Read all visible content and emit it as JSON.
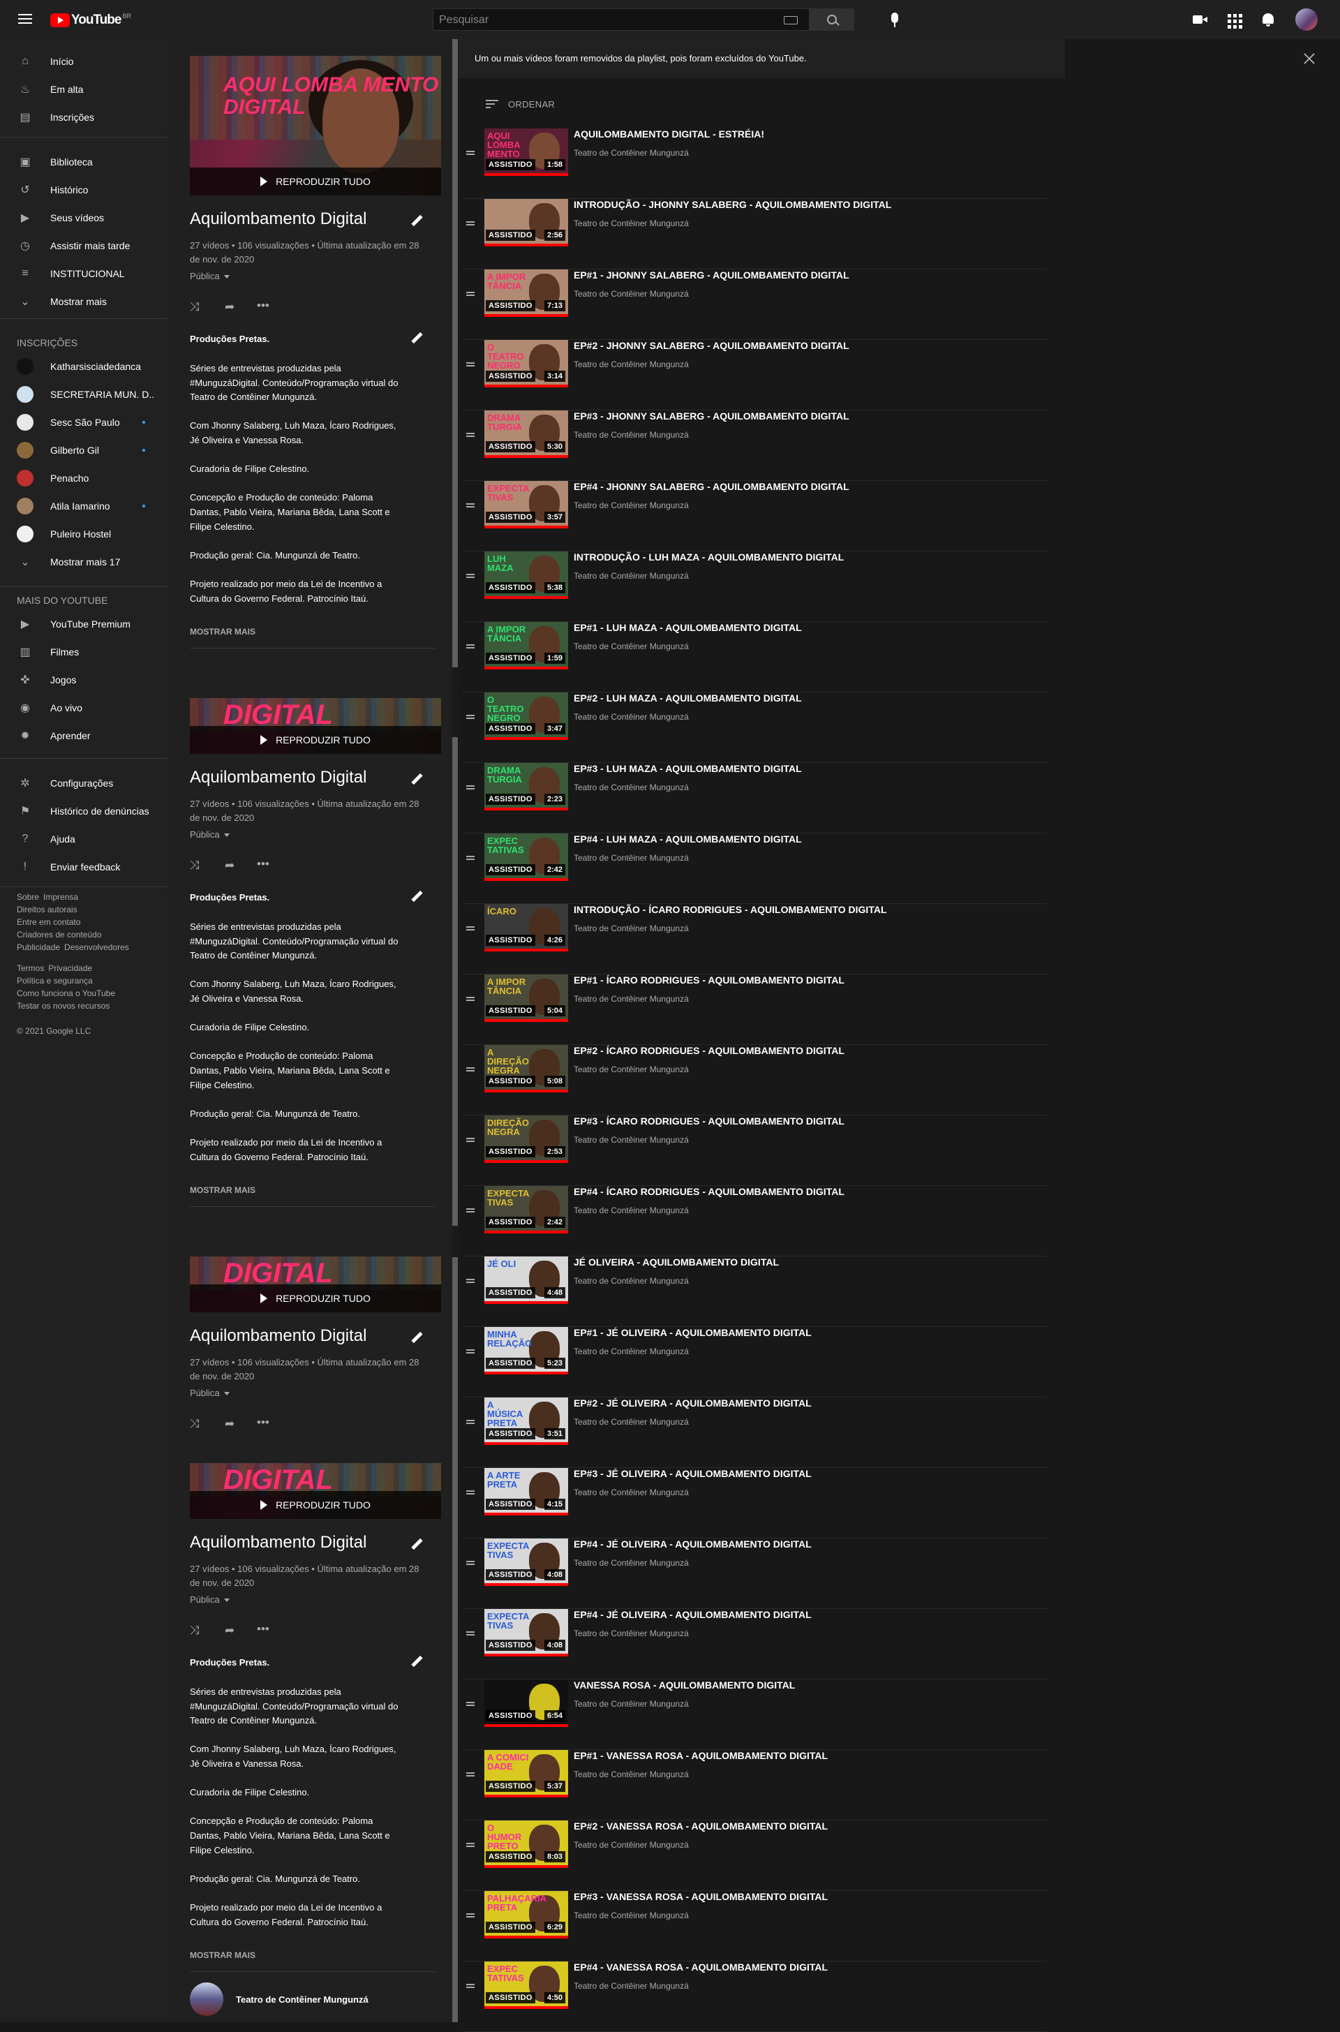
{
  "topbar": {
    "logo": "YouTube",
    "region": "BR",
    "search_placeholder": "Pesquisar"
  },
  "sidebar": {
    "main": [
      {
        "label": "Início",
        "icon": "home-icon"
      },
      {
        "label": "Em alta",
        "icon": "fire-icon"
      },
      {
        "label": "Inscrições",
        "icon": "subscriptions-icon"
      }
    ],
    "library": [
      {
        "label": "Biblioteca",
        "icon": "library-icon"
      },
      {
        "label": "Histórico",
        "icon": "history-icon"
      },
      {
        "label": "Seus vídeos",
        "icon": "your-videos-icon"
      },
      {
        "label": "Assistir mais tarde",
        "icon": "clock-icon"
      },
      {
        "label": "INSTITUCIONAL",
        "icon": "playlist-icon"
      },
      {
        "label": "Mostrar mais",
        "icon": "chevron-down-icon"
      }
    ],
    "subs_header": "INSCRIÇÕES",
    "subs": [
      {
        "label": "Katharsisciadedanca",
        "color": "#111111",
        "dot": false
      },
      {
        "label": "SECRETARIA MUN. D...",
        "color": "#cfe0f0",
        "dot": false
      },
      {
        "label": "Sesc São Paulo",
        "color": "#e8e8e8",
        "dot": true
      },
      {
        "label": "Gilberto Gil",
        "color": "#8a6a3a",
        "dot": true
      },
      {
        "label": "Penacho",
        "color": "#c03030",
        "dot": false
      },
      {
        "label": "Atila Iamarino",
        "color": "#a08060",
        "dot": true
      },
      {
        "label": "Puleiro Hostel",
        "color": "#f0f0f0",
        "dot": false
      },
      {
        "label": "Mostrar mais 17",
        "color": "",
        "dot": false
      }
    ],
    "more_header": "MAIS DO YOUTUBE",
    "more": [
      {
        "label": "YouTube Premium",
        "icon": "youtube-icon"
      },
      {
        "label": "Filmes",
        "icon": "film-icon"
      },
      {
        "label": "Jogos",
        "icon": "gaming-icon"
      },
      {
        "label": "Ao vivo",
        "icon": "live-icon"
      },
      {
        "label": "Aprender",
        "icon": "bulb-icon"
      }
    ],
    "settings": [
      {
        "label": "Configurações",
        "icon": "gear-icon"
      },
      {
        "label": "Histórico de denúncias",
        "icon": "flag-icon"
      },
      {
        "label": "Ajuda",
        "icon": "help-icon"
      },
      {
        "label": "Enviar feedback",
        "icon": "feedback-icon"
      }
    ],
    "footer1": [
      "Sobre",
      "Imprensa",
      "Direitos autorais",
      "Entre em contato",
      "Criadores de conteúdo",
      "Publicidade",
      "Desenvolvedores"
    ],
    "footer2": [
      "Termos",
      "Privacidade",
      "Política e segurança",
      "Como funciona o YouTube",
      "Testar os novos recursos"
    ],
    "copyright": "© 2021 Google LLC"
  },
  "playlist": {
    "hero_text": "AQUI LOMBA MENTO DIGITAL",
    "short_hero_text": "DIGITAL",
    "play_all": "REPRODUZIR TUDO",
    "title": "Aquilombamento Digital",
    "meta": "27 vídeos • 106 visualizações • Última atualização em 28 de nov. de 2020",
    "privacy": "Pública",
    "desc_title": "Produções Pretas.",
    "description": "Séries de entrevistas produzidas pela #MunguzáDigital. Conteúdo/Programação virtual do Teatro de Contêiner Mungunzá.\n\nCom Jhonny Salaberg, Luh Maza, Ícaro Rodrigues, Jé Oliveira e Vanessa Rosa.\n\nCuradoria de Filipe Celestino.\n\nConcepção e Produção de conteúdo: Paloma Dantas, Pablo Vieira, Mariana Bêda, Lana Scott e Filipe Celestino.\n\nProdução geral: Cia. Mungunzá de Teatro.\n\nProjeto realizado por meio da Lei de Incentivo a Cultura do Governo Federal. Patrocínio Itaú.",
    "show_more": "MOSTRAR MAIS",
    "owner": "Teatro de Contêiner Mungunzá"
  },
  "notice": "Um ou mais vídeos foram removidos da playlist, pois foram excluídos do YouTube.",
  "sort_label": "ORDENAR",
  "watched_label": "ASSISTIDO",
  "channel": "Teatro de Contêiner Mungunzá",
  "videos": [
    {
      "title": "AQUILOMBAMENTO DIGITAL - ESTRÉIA!",
      "duration": "1:58",
      "thumb_text": "AQUI LOMBA MENTO",
      "bg": "#5a1f34",
      "fg": "#ff2e6e",
      "skin": "#7a4a34"
    },
    {
      "title": "INTRODUÇÃO - JHONNY SALABERG - AQUILOMBAMENTO DIGITAL",
      "duration": "2:56",
      "thumb_text": "",
      "bg": "#b08a72",
      "fg": "#ff2e6e",
      "skin": "#5a3624"
    },
    {
      "title": "EP#1 - JHONNY SALABERG - AQUILOMBAMENTO DIGITAL",
      "duration": "7:13",
      "thumb_text": "A IMPOR TÂNCIA",
      "bg": "#b08a72",
      "fg": "#ff2e6e",
      "skin": "#5a3624"
    },
    {
      "title": "EP#2 - JHONNY SALABERG - AQUILOMBAMENTO DIGITAL",
      "duration": "3:14",
      "thumb_text": "O TEATRO NEGRO",
      "bg": "#b08a72",
      "fg": "#ff2e6e",
      "skin": "#5a3624"
    },
    {
      "title": "EP#3 - JHONNY SALABERG - AQUILOMBAMENTO DIGITAL",
      "duration": "5:30",
      "thumb_text": "DRAMA TURGIA",
      "bg": "#b08a72",
      "fg": "#ff2e6e",
      "skin": "#5a3624"
    },
    {
      "title": "EP#4 - JHONNY SALABERG - AQUILOMBAMENTO DIGITAL",
      "duration": "3:57",
      "thumb_text": "EXPECTA TIVAS",
      "bg": "#b08a72",
      "fg": "#ff2e6e",
      "skin": "#5a3624"
    },
    {
      "title": "INTRODUÇÃO - LUH MAZA - AQUILOMBAMENTO DIGITAL",
      "duration": "5:38",
      "thumb_text": "LUH MAZA",
      "bg": "#3a5a3a",
      "fg": "#2ee06e",
      "skin": "#5a3624"
    },
    {
      "title": "EP#1 - LUH MAZA - AQUILOMBAMENTO DIGITAL",
      "duration": "1:59",
      "thumb_text": "A IMPOR TÂNCIA",
      "bg": "#3a5a3a",
      "fg": "#2ee06e",
      "skin": "#5a3624"
    },
    {
      "title": "EP#2 - LUH MAZA - AQUILOMBAMENTO DIGITAL",
      "duration": "3:47",
      "thumb_text": "O TEATRO NEGRO",
      "bg": "#3a5a3a",
      "fg": "#2ee06e",
      "skin": "#5a3624"
    },
    {
      "title": "EP#3 - LUH MAZA - AQUILOMBAMENTO DIGITAL",
      "duration": "2:23",
      "thumb_text": "DRAMA TURGIA",
      "bg": "#3a5a3a",
      "fg": "#2ee06e",
      "skin": "#5a3624"
    },
    {
      "title": "EP#4 - LUH MAZA - AQUILOMBAMENTO DIGITAL",
      "duration": "2:42",
      "thumb_text": "EXPEC TATIVAS",
      "bg": "#3a5a3a",
      "fg": "#2ee06e",
      "skin": "#5a3624"
    },
    {
      "title": "INTRODUÇÃO - ÍCARO RODRIGUES - AQUILOMBAMENTO DIGITAL",
      "duration": "4:26",
      "thumb_text": "ÍCARO",
      "bg": "#3a3a3a",
      "fg": "#e0c030",
      "skin": "#4a2e1e"
    },
    {
      "title": "EP#1 - ÍCARO RODRIGUES - AQUILOMBAMENTO DIGITAL",
      "duration": "5:04",
      "thumb_text": "A IMPOR TÂNCIA",
      "bg": "#4a4a3a",
      "fg": "#e0c030",
      "skin": "#4a2e1e"
    },
    {
      "title": "EP#2 - ÍCARO RODRIGUES - AQUILOMBAMENTO DIGITAL",
      "duration": "5:08",
      "thumb_text": "A DIREÇÃO NEGRA",
      "bg": "#4a4a3a",
      "fg": "#e0c030",
      "skin": "#4a2e1e"
    },
    {
      "title": "EP#3 - ÍCARO RODRIGUES - AQUILOMBAMENTO DIGITAL",
      "duration": "2:53",
      "thumb_text": "DIREÇÃO NEGRA",
      "bg": "#4a4a3a",
      "fg": "#e0c030",
      "skin": "#4a2e1e"
    },
    {
      "title": "EP#4 - ÍCARO RODRIGUES - AQUILOMBAMENTO DIGITAL",
      "duration": "2:42",
      "thumb_text": "EXPECTA TIVAS",
      "bg": "#4a4a3a",
      "fg": "#e0c030",
      "skin": "#4a2e1e"
    },
    {
      "title": "JÉ OLIVEIRA - AQUILOMBAMENTO DIGITAL",
      "duration": "4:48",
      "thumb_text": "JÉ OLI",
      "bg": "#d8d8d8",
      "fg": "#2a5bd8",
      "skin": "#4a2e1e"
    },
    {
      "title": "EP#1 - JÉ OLIVEIRA - AQUILOMBAMENTO DIGITAL",
      "duration": "5:23",
      "thumb_text": "MINHA RELAÇÃO",
      "bg": "#d8d8d8",
      "fg": "#2a5bd8",
      "skin": "#4a2e1e"
    },
    {
      "title": "EP#2 - JÉ OLIVEIRA - AQUILOMBAMENTO DIGITAL",
      "duration": "3:51",
      "thumb_text": "A MÚSICA PRETA",
      "bg": "#d8d8d8",
      "fg": "#2a5bd8",
      "skin": "#4a2e1e"
    },
    {
      "title": "EP#3 - JÉ OLIVEIRA - AQUILOMBAMENTO DIGITAL",
      "duration": "4:15",
      "thumb_text": "A ARTE PRETA",
      "bg": "#d8d8d8",
      "fg": "#2a5bd8",
      "skin": "#4a2e1e"
    },
    {
      "title": "EP#4 - JÉ OLIVEIRA - AQUILOMBAMENTO DIGITAL",
      "duration": "4:08",
      "thumb_text": "EXPECTA TIVAS",
      "bg": "#d8d8d8",
      "fg": "#2a5bd8",
      "skin": "#4a2e1e"
    },
    {
      "title": "EP#4 - JÉ OLIVEIRA - AQUILOMBAMENTO DIGITAL",
      "duration": "4:08",
      "thumb_text": "EXPECTA TIVAS",
      "bg": "#d8d8d8",
      "fg": "#2a5bd8",
      "skin": "#4a2e1e"
    },
    {
      "title": "VANESSA ROSA - AQUILOMBAMENTO DIGITAL",
      "duration": "6:54",
      "thumb_text": "",
      "bg": "#111111",
      "fg": "#e0e040",
      "skin": "#d0c020"
    },
    {
      "title": "EP#1 - VANESSA ROSA - AQUILOMBAMENTO DIGITAL",
      "duration": "5:37",
      "thumb_text": "A COMICI DADE",
      "bg": "#d8c820",
      "fg": "#ff2e9e",
      "skin": "#5a3624"
    },
    {
      "title": "EP#2 - VANESSA ROSA - AQUILOMBAMENTO DIGITAL",
      "duration": "8:03",
      "thumb_text": "O HUMOR PRETO",
      "bg": "#d8c820",
      "fg": "#ff2e9e",
      "skin": "#5a3624"
    },
    {
      "title": "EP#3 - VANESSA ROSA - AQUILOMBAMENTO DIGITAL",
      "duration": "6:29",
      "thumb_text": "PALHAÇARIA PRETA",
      "bg": "#d8c820",
      "fg": "#ff2e9e",
      "skin": "#5a3624"
    },
    {
      "title": "EP#4 - VANESSA ROSA - AQUILOMBAMENTO DIGITAL",
      "duration": "4:50",
      "thumb_text": "EXPEC TATIVAS",
      "bg": "#d8c820",
      "fg": "#ff2e9e",
      "skin": "#5a3624"
    }
  ]
}
